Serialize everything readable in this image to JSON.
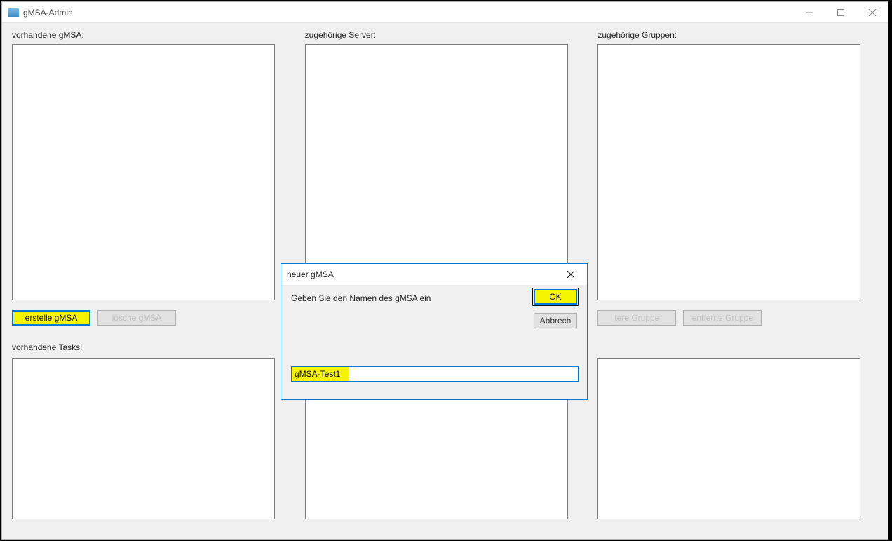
{
  "window": {
    "title": "gMSA-Admin"
  },
  "panels": {
    "gmsa_label": "vorhandene gMSA:",
    "servers_label": "zugehörige Server:",
    "groups_label": "zugehörige Gruppen:",
    "tasks_label": "vorhandene Tasks:"
  },
  "buttons": {
    "create_gmsa": "erstelle gMSA",
    "delete_gmsa": "lösche gMSA",
    "more_group": "tere Gruppe",
    "remove_group": "entferne Gruppe"
  },
  "dialog": {
    "title": "neuer gMSA",
    "prompt": "Geben Sie den Namen des gMSA ein",
    "ok": "OK",
    "cancel": "Abbrech",
    "input_value": "gMSA-Test1"
  }
}
